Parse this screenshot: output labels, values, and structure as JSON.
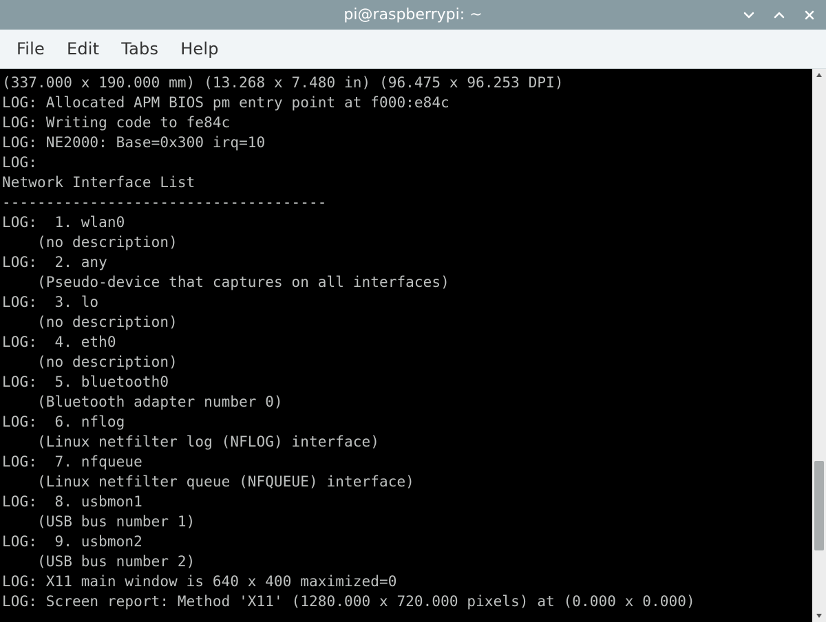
{
  "titlebar": {
    "title": "pi@raspberrypi: ~"
  },
  "menubar": {
    "items": [
      "File",
      "Edit",
      "Tabs",
      "Help"
    ]
  },
  "terminal": {
    "lines": [
      "(337.000 x 190.000 mm) (13.268 x 7.480 in) (96.475 x 96.253 DPI)",
      "LOG: Allocated APM BIOS pm entry point at f000:e84c",
      "LOG: Writing code to fe84c",
      "LOG: NE2000: Base=0x300 irq=10",
      "LOG:",
      "Network Interface List",
      "-------------------------------------",
      "LOG:  1. wlan0",
      "    (no description)",
      "LOG:  2. any",
      "    (Pseudo-device that captures on all interfaces)",
      "LOG:  3. lo",
      "    (no description)",
      "LOG:  4. eth0",
      "    (no description)",
      "LOG:  5. bluetooth0",
      "    (Bluetooth adapter number 0)",
      "LOG:  6. nflog",
      "    (Linux netfilter log (NFLOG) interface)",
      "LOG:  7. nfqueue",
      "    (Linux netfilter queue (NFQUEUE) interface)",
      "LOG:  8. usbmon1",
      "    (USB bus number 1)",
      "LOG:  9. usbmon2",
      "    (USB bus number 2)",
      "LOG: X11 main window is 640 x 400 maximized=0",
      "LOG: Screen report: Method 'X11' (1280.000 x 720.000 pixels) at (0.000 x 0.000)"
    ]
  }
}
